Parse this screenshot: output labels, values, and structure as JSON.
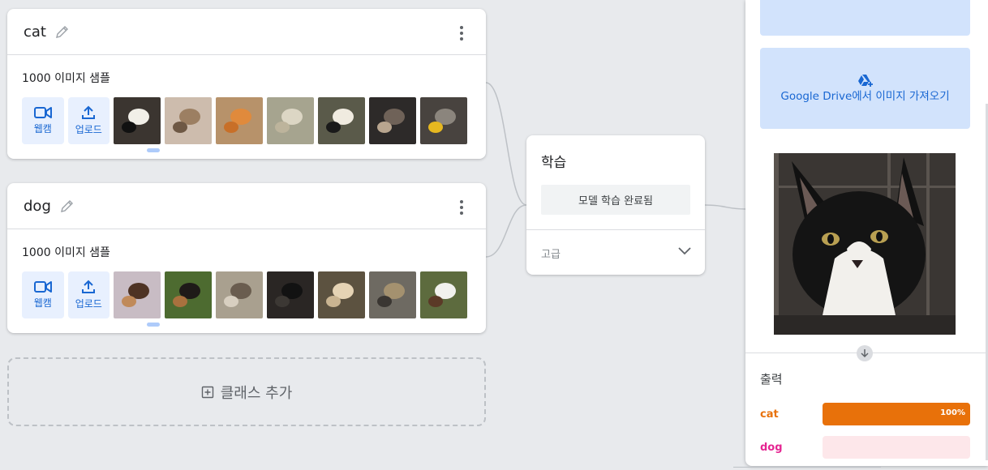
{
  "classes": [
    {
      "name": "cat",
      "sample_count": "1000 이미지 샘플",
      "webcam_label": "웹캠",
      "upload_label": "업로드",
      "thumbs": [
        {
          "bg": "#3b3530",
          "a": "#f1efe8",
          "b": "#111111"
        },
        {
          "bg": "#cdbcad",
          "a": "#9c7f62",
          "b": "#6e5844"
        },
        {
          "bg": "#b7926a",
          "a": "#e08a3c",
          "b": "#c86f28"
        },
        {
          "bg": "#a6a48f",
          "a": "#dcd6c4",
          "b": "#bdb49c"
        },
        {
          "bg": "#5a5a4a",
          "a": "#f0ebe0",
          "b": "#1a1a1a"
        },
        {
          "bg": "#2d2a29",
          "a": "#6f6258",
          "b": "#b8a58f"
        },
        {
          "bg": "#48433f",
          "a": "#8b857d",
          "b": "#e6b820"
        }
      ]
    },
    {
      "name": "dog",
      "sample_count": "1000 이미지 샘플",
      "webcam_label": "웹캠",
      "upload_label": "업로드",
      "thumbs": [
        {
          "bg": "#c8bcc4",
          "a": "#4e3324",
          "b": "#c08a5a"
        },
        {
          "bg": "#4d6b30",
          "a": "#1e1a18",
          "b": "#a9713e"
        },
        {
          "bg": "#a9a08f",
          "a": "#6a5d4f",
          "b": "#d8cfc0"
        },
        {
          "bg": "#2a2624",
          "a": "#121212",
          "b": "#3c3834"
        },
        {
          "bg": "#5c5240",
          "a": "#e5d3b4",
          "b": "#c9b491"
        },
        {
          "bg": "#6e6a62",
          "a": "#a4916f",
          "b": "#3a3632"
        },
        {
          "bg": "#5d6b3e",
          "a": "#f1f1ed",
          "b": "#5b3a27"
        }
      ]
    }
  ],
  "add_class_label": "클래스 추가",
  "training": {
    "title": "학습",
    "button_label": "모델 학습 완료됨",
    "advanced_label": "고급"
  },
  "preview": {
    "drive_button_label": "Google Drive에서 이미지 가져오기",
    "output_title": "출력",
    "outputs": [
      {
        "label": "cat",
        "percent_text": "100%",
        "value": 1.0,
        "color": "#e8710a",
        "track": "#fde3cf"
      },
      {
        "label": "dog",
        "percent_text": "",
        "value": 0.0,
        "color": "#e52592",
        "track": "#fde7ea"
      }
    ]
  }
}
